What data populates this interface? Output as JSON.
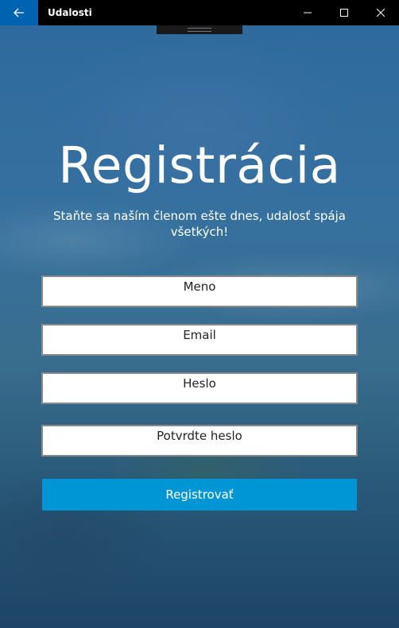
{
  "window": {
    "title": "Udalosti",
    "back_icon": "back-arrow-icon",
    "controls": [
      "minimize-icon",
      "maximize-icon",
      "close-icon"
    ]
  },
  "page": {
    "heading": "Registrácia",
    "subtitle": "Staňte sa naším členom ešte dnes, udalosť spája všetkých!"
  },
  "form": {
    "name_placeholder": "Meno",
    "email_placeholder": "Email",
    "password_placeholder": "Heslo",
    "confirm_placeholder": "Potvrdte heslo",
    "submit_label": "Registrovať"
  },
  "colors": {
    "accent": "#0096d6",
    "back_button": "#0063b1",
    "titlebar": "#000000"
  }
}
